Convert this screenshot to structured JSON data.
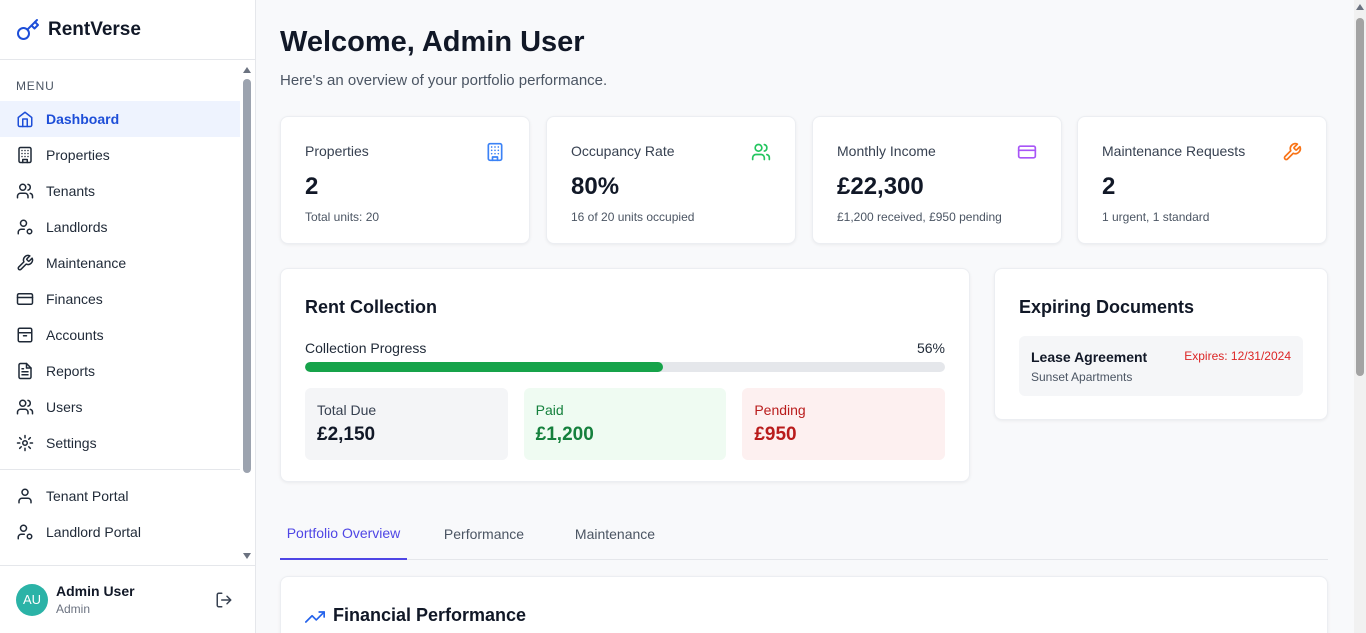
{
  "brand": {
    "name": "RentVerse",
    "color": "#1d4ed8"
  },
  "sidebar": {
    "menu_label": "MENU",
    "items": [
      {
        "label": "Dashboard",
        "icon": "home-icon",
        "active": true
      },
      {
        "label": "Properties",
        "icon": "building-icon"
      },
      {
        "label": "Tenants",
        "icon": "users-icon"
      },
      {
        "label": "Landlords",
        "icon": "user-cog-icon"
      },
      {
        "label": "Maintenance",
        "icon": "wrench-icon"
      },
      {
        "label": "Finances",
        "icon": "credit-card-icon"
      },
      {
        "label": "Accounts",
        "icon": "archive-icon"
      },
      {
        "label": "Reports",
        "icon": "file-text-icon"
      },
      {
        "label": "Users",
        "icon": "users-icon"
      },
      {
        "label": "Settings",
        "icon": "gear-icon"
      }
    ],
    "portals": [
      {
        "label": "Tenant Portal",
        "icon": "user-icon"
      },
      {
        "label": "Landlord Portal",
        "icon": "user-cog-icon"
      }
    ],
    "user": {
      "initials": "AU",
      "name": "Admin User",
      "role": "Admin"
    }
  },
  "header": {
    "title": "Welcome, Admin User",
    "subtitle": "Here's an overview of your portfolio performance."
  },
  "stats": [
    {
      "label": "Properties",
      "value": "2",
      "sub": "Total units: 20",
      "icon": "building-icon",
      "color": "#3b82f6"
    },
    {
      "label": "Occupancy Rate",
      "value": "80%",
      "sub": "16 of 20 units occupied",
      "icon": "users-icon",
      "color": "#22c55e"
    },
    {
      "label": "Monthly Income",
      "value": "£22,300",
      "sub": "£1,200 received, £950 pending",
      "icon": "credit-card-icon",
      "color": "#a855f7"
    },
    {
      "label": "Maintenance Requests",
      "value": "2",
      "sub": "1 urgent, 1 standard",
      "icon": "wrench-icon",
      "color": "#f97316"
    }
  ],
  "rent_collection": {
    "title": "Rent Collection",
    "progress_label": "Collection Progress",
    "progress_text": "56%",
    "progress": 0.56,
    "total_due_label": "Total Due",
    "total_due": "£2,150",
    "paid_label": "Paid",
    "paid": "£1,200",
    "pending_label": "Pending",
    "pending": "£950"
  },
  "expiring": {
    "title": "Expiring Documents",
    "docs": [
      {
        "name": "Lease Agreement",
        "location": "Sunset Apartments",
        "expires": "Expires: 12/31/2024"
      }
    ]
  },
  "tabs": [
    {
      "label": "Portfolio Overview",
      "active": true
    },
    {
      "label": "Performance"
    },
    {
      "label": "Maintenance"
    }
  ],
  "financial": {
    "title": "Financial Performance",
    "icon": "trending-up-icon"
  }
}
